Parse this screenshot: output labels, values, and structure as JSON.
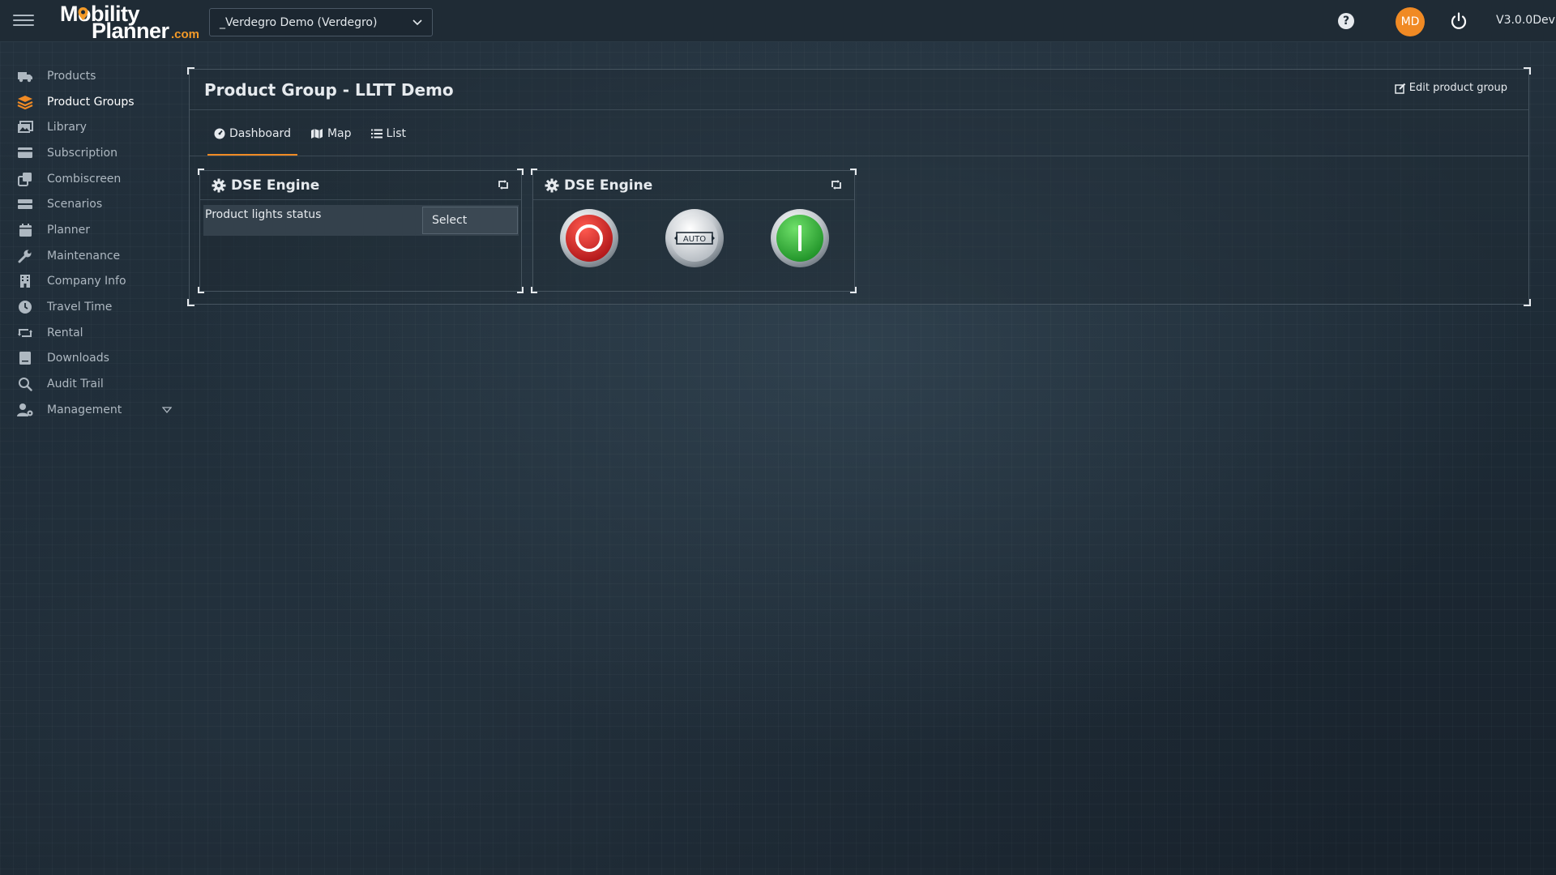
{
  "brand": {
    "line1": "Mobility",
    "line2": "Planner",
    "suffix": ".com"
  },
  "org_selector": {
    "value": "_Verdegro Demo (Verdegro)"
  },
  "topbar": {
    "help": "?",
    "avatar_initials": "MD",
    "version": "V3.0.0Dev"
  },
  "sidebar": {
    "items": [
      {
        "label": "Products",
        "icon": "truck-icon"
      },
      {
        "label": "Product Groups",
        "icon": "layers-icon",
        "active": true
      },
      {
        "label": "Library",
        "icon": "images-icon"
      },
      {
        "label": "Subscription",
        "icon": "credit-card-icon"
      },
      {
        "label": "Combiscreen",
        "icon": "clone-icon"
      },
      {
        "label": "Scenarios",
        "icon": "stack-icon"
      },
      {
        "label": "Planner",
        "icon": "calendar-icon"
      },
      {
        "label": "Maintenance",
        "icon": "wrench-icon"
      },
      {
        "label": "Company Info",
        "icon": "building-icon"
      },
      {
        "label": "Travel Time",
        "icon": "clock-icon"
      },
      {
        "label": "Rental",
        "icon": "retweet-icon"
      },
      {
        "label": "Downloads",
        "icon": "download-icon"
      },
      {
        "label": "Audit Trail",
        "icon": "search-icon"
      },
      {
        "label": "Management",
        "icon": "user-cog-icon"
      }
    ]
  },
  "panel": {
    "title": "Product Group - LLTT Demo",
    "edit_label": "Edit product group",
    "tabs": [
      {
        "label": "Dashboard",
        "icon": "dashboard-icon",
        "active": true
      },
      {
        "label": "Map",
        "icon": "map-icon"
      },
      {
        "label": "List",
        "icon": "list-icon"
      }
    ]
  },
  "widgets": [
    {
      "title": "DSE Engine",
      "row_label": "Product lights status",
      "select_label": "Select"
    },
    {
      "title": "DSE Engine",
      "buttons": [
        {
          "name": "stop",
          "color": "#d9282a"
        },
        {
          "name": "auto",
          "label": "AUTO",
          "color": "#c9ced3"
        },
        {
          "name": "start",
          "color": "#3bb43a"
        }
      ]
    }
  ],
  "colors": {
    "accent": "#f08a24",
    "brand_orange": "#f39a28"
  }
}
